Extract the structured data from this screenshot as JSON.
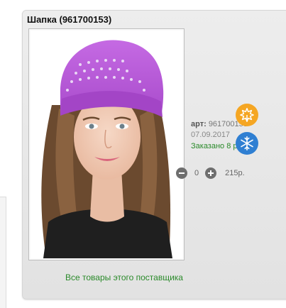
{
  "product": {
    "title": "Шапка (961700153)",
    "image_alt": "Шапка"
  },
  "details": {
    "sku_label": "арт:",
    "sku_value": "961700153",
    "date": "07.09.2017",
    "ordered": "Заказано 8 раз"
  },
  "season_icons": [
    "autumn-leaf-icon",
    "winter-snowflake-icon"
  ],
  "colors": {
    "autumn": "#f5a623",
    "winter": "#2f7fd2",
    "link": "#2a8a2a",
    "hat": "#b957d9"
  },
  "quantity": {
    "value": "0",
    "price": "215р."
  },
  "footer": {
    "supplier_link": "Все товары этого поставщика"
  }
}
